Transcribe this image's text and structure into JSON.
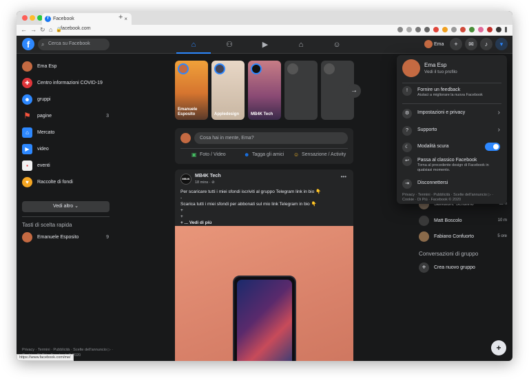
{
  "browser": {
    "tab_title": "Facebook",
    "tab_close": "×",
    "new_tab": "+",
    "url": "facebook.com",
    "status_url": "https://www.facebook.com/me/"
  },
  "header": {
    "search_placeholder": "Cerca su Facebook",
    "user_name": "Ema"
  },
  "left_nav": {
    "items": [
      {
        "label": "Ema Esp",
        "icon": "avatar",
        "count": ""
      },
      {
        "label": "Centro informazioni COVID-19",
        "icon": "covid-icon",
        "count": ""
      },
      {
        "label": "gruppi",
        "icon": "groups-icon",
        "count": ""
      },
      {
        "label": "pagine",
        "icon": "flag-icon",
        "count": "3"
      },
      {
        "label": "Mercato",
        "icon": "marketplace-icon",
        "count": ""
      },
      {
        "label": "video",
        "icon": "video-icon",
        "count": ""
      },
      {
        "label": "eventi",
        "icon": "calendar-icon",
        "count": ""
      },
      {
        "label": "Raccolte di fondi",
        "icon": "fundraiser-icon",
        "count": ""
      }
    ],
    "see_more": "Vedi altro",
    "shortcuts_title": "Tasti di scelta rapida",
    "shortcut": {
      "label": "Emanuele Esposito",
      "count": "9"
    },
    "footer": "Privacy · Termini · Pubblicità · Scelte dell'annuncio ▷ · Cookie · Di Più · Facebook © 2020"
  },
  "stories": [
    {
      "name": "Emanuele Esposito"
    },
    {
      "name": "Appledesign"
    },
    {
      "name": "MB4K Tech"
    }
  ],
  "composer": {
    "placeholder": "Cosa hai in mente, Ema?",
    "actions": [
      "Foto / Video",
      "Tagga gli amici",
      "Sensazione / Activity"
    ]
  },
  "post": {
    "author": "MB4K Tech",
    "time": "18 mins · ⊘",
    "avatar_text": "MB4K",
    "line1": "Per scaricare tutti i miei sfondi iscriviti al gruppo Telegram link in bio 👇",
    "line2": "-",
    "line3": "Scarica tutti i miei sfondi per abbonati sul mio link Telegram in bio 👇",
    "line4": "+",
    "line5": "+",
    "line6": "+ ... Vedi di più"
  },
  "contacts": [
    {
      "name": "Salvatore Serafino",
      "time": "12 h"
    },
    {
      "name": "Matt Boscolo",
      "time": "10 m"
    },
    {
      "name": "Fabiano Confuorto",
      "time": "5 ore"
    }
  ],
  "group_convos": {
    "title": "Conversazioni di gruppo",
    "new_group": "Crea nuovo gruppo"
  },
  "dropdown": {
    "profile_name": "Ema Esp",
    "profile_sub": "Vedi il tuo profilo",
    "feedback_title": "Fornire un feedback",
    "feedback_sub": "Aiutaci a migliorare la nuova Facebook",
    "settings": "Impostazioni e privacy",
    "support": "Supporto",
    "dark_mode": "Modalità scura",
    "dark_mode_on": true,
    "classic_title": "Passa al classico Facebook",
    "classic_sub": "Torna al precedente design di Facebook in qualsiasi momento.",
    "logout": "Disconnettersi",
    "footer": "Privacy · Termini · Pubblicità · Scelte dell'annuncio ▷ · Cookie · Di Più · Facebook © 2020"
  },
  "colors": {
    "accent": "#2d88ff",
    "bg": "#18191a",
    "card": "#242526"
  }
}
